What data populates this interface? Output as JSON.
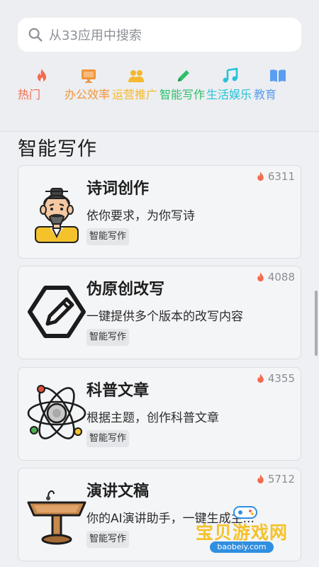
{
  "search": {
    "placeholder": "从33应用中搜索"
  },
  "categories": [
    {
      "label": "热门",
      "icon": "fire-icon",
      "color": "#f26b4e"
    },
    {
      "label": "办公效率",
      "icon": "monitor-icon",
      "color": "#f2953a"
    },
    {
      "label": "运营推广",
      "icon": "users-icon",
      "color": "#f5b82e"
    },
    {
      "label": "智能写作",
      "icon": "pen-icon",
      "color": "#2fbf6b"
    },
    {
      "label": "生活娱乐",
      "icon": "music-icon",
      "color": "#26c2d9"
    },
    {
      "label": "教育",
      "icon": "book-icon",
      "color": "#5b9df0"
    }
  ],
  "section": {
    "title": "智能写作"
  },
  "cards": [
    {
      "title": "诗词创作",
      "desc": "依你要求，为你写诗",
      "tag": "智能写作",
      "heat": "6311",
      "icon": "poet-icon"
    },
    {
      "title": "伪原创改写",
      "desc": "一键提供多个版本的改写内容",
      "tag": "智能写作",
      "heat": "4088",
      "icon": "edit-hexagon-icon"
    },
    {
      "title": "科普文章",
      "desc": "根据主题，创作科普文章",
      "tag": "智能写作",
      "heat": "4355",
      "icon": "atom-icon"
    },
    {
      "title": "演讲文稿",
      "desc": "你的AI演讲助手，一键生成主...",
      "tag": "智能写作",
      "heat": "5712",
      "icon": "podium-icon"
    }
  ],
  "watermark": {
    "text": "宝贝游戏网",
    "url": "baobeiy.com"
  },
  "colors": {
    "heat": "#f26b4e",
    "background": "#eef0f3",
    "card": "#f4f5f7"
  }
}
